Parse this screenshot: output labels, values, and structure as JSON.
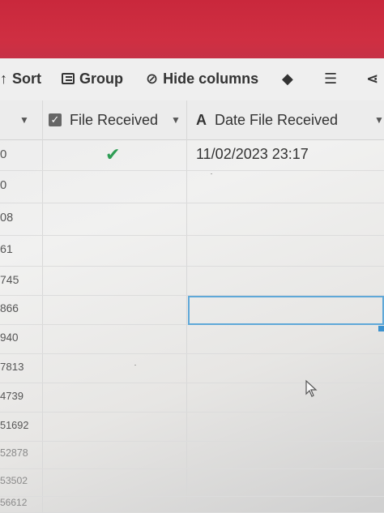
{
  "toolbar": {
    "sort_label": "Sort",
    "group_label": "Group",
    "hide_columns_label": "Hide columns"
  },
  "header": {
    "col_file_received": "File Received",
    "col_date_file_received": "Date File Received",
    "col_type_icon_text": "A"
  },
  "rows": [
    {
      "num": "0",
      "file_received": true,
      "date": "11/02/2023 23:17"
    },
    {
      "num": "0",
      "file_received": false,
      "date": ""
    },
    {
      "num": "08",
      "file_received": false,
      "date": ""
    },
    {
      "num": "61",
      "file_received": false,
      "date": ""
    },
    {
      "num": "745",
      "file_received": false,
      "date": ""
    },
    {
      "num": "866",
      "file_received": false,
      "date": ""
    },
    {
      "num": "940",
      "file_received": false,
      "date": ""
    },
    {
      "num": "7813",
      "file_received": false,
      "date": ""
    },
    {
      "num": "4739",
      "file_received": false,
      "date": ""
    },
    {
      "num": "51692",
      "file_received": false,
      "date": ""
    },
    {
      "num": "52878",
      "file_received": false,
      "date": ""
    },
    {
      "num": "53502",
      "file_received": false,
      "date": ""
    },
    {
      "num": "56612",
      "file_received": false,
      "date": ""
    }
  ],
  "colors": {
    "top_bar": "#cc2d40",
    "check": "#2e9d54",
    "selection": "#5fa8d8"
  }
}
